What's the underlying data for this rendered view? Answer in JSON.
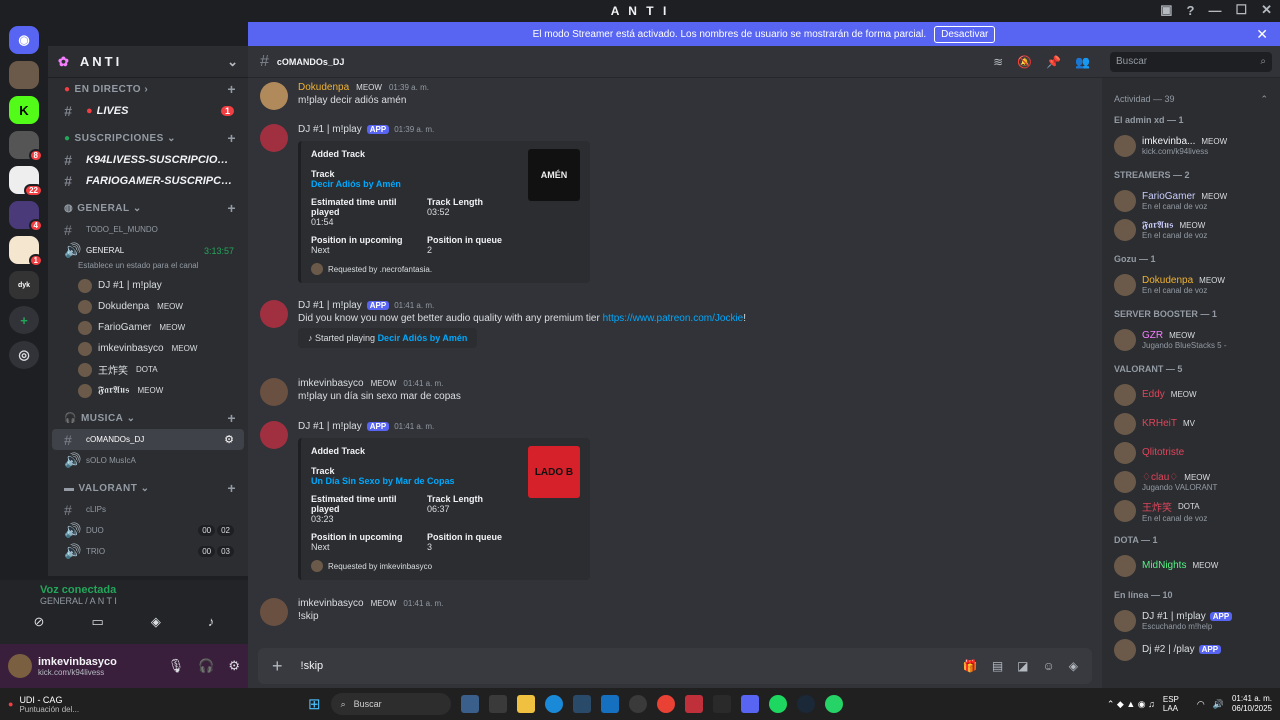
{
  "window": {
    "title": "A N T I"
  },
  "banner": {
    "text": "El modo Streamer está activado. Los nombres de usuario se mostrarán de forma parcial.",
    "button": "Desactivar"
  },
  "server": {
    "name": "ANTI"
  },
  "categories": {
    "en_directo": "EN DIRECTO",
    "suscripciones": "SUSCRIPCIONES",
    "general": "GENERAL",
    "musica": "MUSICA",
    "valorant": "VALORANT"
  },
  "channels": {
    "lives": "LIVES",
    "lives_unread": "1",
    "k94": "K94LIVESS-SUSCRIPCIONE...",
    "fario": "FARIOGAMER-SUSCRIPCIO...",
    "todo": "TODO_EL_MUNDO",
    "general_voice": "GENERAL",
    "general_time": "3:13:57",
    "general_status": "Establece un estado para el canal",
    "comandos": "cOMANDOs_DJ",
    "solo": "sOLO MusIcA",
    "clips": "cLIPs",
    "duo": "DUO",
    "trio": "TRIO",
    "duo_counts": [
      "00",
      "02"
    ],
    "trio_counts": [
      "00",
      "03"
    ]
  },
  "voice_users": [
    {
      "name": "DJ #1 | m!play",
      "tag": ""
    },
    {
      "name": "Dokudenpa",
      "tag": "MEOW"
    },
    {
      "name": "FarioGamer",
      "tag": "MEOW"
    },
    {
      "name": "imkevinbasyco",
      "tag": "MEOW"
    },
    {
      "name": "王炸笑",
      "tag": "DOTA"
    },
    {
      "name": "𝕱𝖆𝖗𝕬𝖚𝖘",
      "tag": "MEOW"
    }
  ],
  "voice_connected": {
    "title": "Voz conectada",
    "sub": "GENERAL / A N T I"
  },
  "user": {
    "name": "imkevinbasyco",
    "sub": "kick.com/k94livess"
  },
  "chat_header": {
    "channel": "cOMANDOs_DJ"
  },
  "search": {
    "placeholder": "Buscar"
  },
  "messages": {
    "m1": {
      "author": "Dokudenpa",
      "tag": "MEOW",
      "time": "01:39 a. m.",
      "text": "m!play decir adiós amén"
    },
    "m2": {
      "author": "DJ #1 | m!play",
      "badge": "APP",
      "time": "01:39 a. m.",
      "embed": {
        "title": "Added Track",
        "track_label": "Track",
        "track": "Decir Adiós by Amén",
        "eta_label": "Estimated time until played",
        "eta": "01:54",
        "len_label": "Track Length",
        "len": "03:52",
        "pos_label": "Position in upcoming",
        "pos": "Next",
        "queue_label": "Position in queue",
        "queue": "2",
        "footer": "Requested by .necrofantasia.",
        "thumb_text": "AMÉN"
      }
    },
    "m3": {
      "author": "DJ #1 | m!play",
      "badge": "APP",
      "time": "01:41 a. m.",
      "text": "Did you know you now get better audio quality with any premium tier ",
      "link": "https://www.patreon.com/Jockie",
      "tail": "!",
      "mini_pre": "Started playing ",
      "mini_song": "Decir Adiós by Amén"
    },
    "m4": {
      "author": "imkevinbasyco",
      "tag": "MEOW",
      "time": "01:41 a. m.",
      "text": "m!play un día sin sexo mar de copas"
    },
    "m5": {
      "author": "DJ #1 | m!play",
      "badge": "APP",
      "time": "01:41 a. m.",
      "embed": {
        "title": "Added Track",
        "track_label": "Track",
        "track": "Un Día Sin Sexo by Mar de Copas",
        "eta_label": "Estimated time until played",
        "eta": "03:23",
        "len_label": "Track Length",
        "len": "06:37",
        "pos_label": "Position in upcoming",
        "pos": "Next",
        "queue_label": "Position in queue",
        "queue": "3",
        "footer": "Requested by imkevinbasyco",
        "thumb_text": "LADO B"
      }
    },
    "m6": {
      "author": "imkevinbasyco",
      "tag": "MEOW",
      "time": "01:41 a. m.",
      "text": "!skip"
    }
  },
  "input": {
    "value": "!skip"
  },
  "members": {
    "activity": "Actividad — 39",
    "groups": [
      {
        "title": "El admin xd — 1",
        "items": [
          {
            "name": "imkevinba...",
            "tag": "MEOW",
            "status": "kick.com/k94livess",
            "color": "#f2f3f5"
          }
        ]
      },
      {
        "title": "STREAMERS — 2",
        "items": [
          {
            "name": "FarioGamer",
            "tag": "MEOW",
            "status": "En el canal de voz",
            "color": "#c9cdfb"
          },
          {
            "name": "𝕱𝖆𝖗𝕬𝖚𝖘",
            "tag": "MEOW",
            "status": "En el canal de voz",
            "color": "#c9cdfb"
          }
        ]
      },
      {
        "title": "Gozu — 1",
        "items": [
          {
            "name": "Dokudenpa",
            "tag": "MEOW",
            "status": "En el canal de voz",
            "color": "#f0b232"
          }
        ]
      },
      {
        "title": "SERVER BOOSTER — 1",
        "items": [
          {
            "name": "GZR",
            "tag": "MEOW",
            "status": "Jugando BlueStacks 5 -",
            "color": "#f47fff"
          }
        ]
      },
      {
        "title": "VALORANT — 5",
        "items": [
          {
            "name": "Eddy",
            "tag": "MEOW",
            "status": "",
            "color": "#e0455a"
          },
          {
            "name": "KRHeiT",
            "tag": "MV",
            "status": "",
            "color": "#e0455a"
          },
          {
            "name": "Qlitotriste",
            "tag": "",
            "status": "",
            "color": "#e0455a"
          },
          {
            "name": "♢clau♢",
            "tag": "MEOW",
            "status": "Jugando VALORANT",
            "color": "#e0455a"
          },
          {
            "name": "王炸笑",
            "tag": "DOTA",
            "status": "En el canal de voz",
            "color": "#e0455a"
          }
        ]
      },
      {
        "title": "DOTA — 1",
        "items": [
          {
            "name": "MidNights",
            "tag": "MEOW",
            "status": "",
            "color": "#57f287"
          }
        ]
      },
      {
        "title": "En línea — 10",
        "items": [
          {
            "name": "DJ #1 | m!play",
            "tag": "APP",
            "status": "Escuchando m!help",
            "color": "#dbdee1"
          },
          {
            "name": "Dj #2 | /play",
            "tag": "APP",
            "status": "",
            "color": "#dbdee1"
          }
        ]
      }
    ]
  },
  "taskbar": {
    "weather_title": "UDI - CAG",
    "weather_sub": "Puntuación del...",
    "search": "Buscar",
    "lang": "ESP LAA",
    "time": "01:41 a. m.",
    "date": "06/10/2025"
  }
}
